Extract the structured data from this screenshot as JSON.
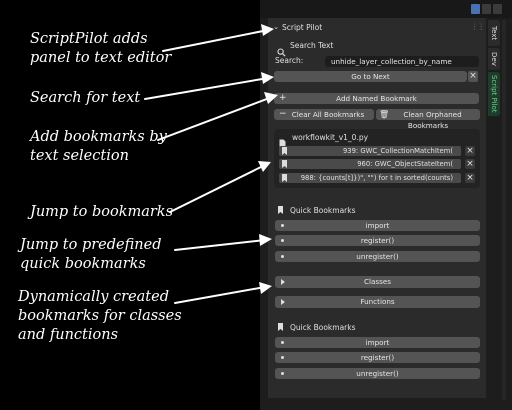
{
  "annotations": [
    "ScriptPilot adds",
    "panel to text editor",
    "Search for text",
    "Add bookmarks by",
    "text selection",
    "Jump to bookmarks",
    "Jump to predefined",
    "quick  bookmarks",
    "Dynamically created",
    "bookmarks for classes",
    "and functions"
  ],
  "panel": {
    "title": "Script Pilot",
    "search_header": "Search Text",
    "search_label": "Search:",
    "search_value": "unhide_layer_collection_by_name",
    "go_next": "Go to Next",
    "add_named": "Add Named Bookmark",
    "clear_all": "Clear All Bookmarks",
    "clean_orphaned": "Clean Orphaned Bookmarks",
    "file_name": "workflowkit_v1_0.py",
    "bookmarks": [
      "939: GWC_CollectionMatchItem(",
      "960: GWC_ObjectStateItem(",
      "988: {counts[t]})\", \"\") for t in sorted(counts)"
    ],
    "quick_title_1": "Quick Bookmarks",
    "quick_items_1": [
      "import",
      "register()",
      "unregister()"
    ],
    "dynamic_items": [
      "Classes",
      "Functions"
    ],
    "quick_title_2": "Quick Bookmarks",
    "quick_items_2": [
      "import",
      "register()",
      "unregister()"
    ]
  },
  "tabs": [
    "Text",
    "Dev",
    "Script Pilot"
  ],
  "colors": {
    "active_tab": "#6fd38f",
    "button": "#545454",
    "panel_bg": "#2b2b2b"
  }
}
